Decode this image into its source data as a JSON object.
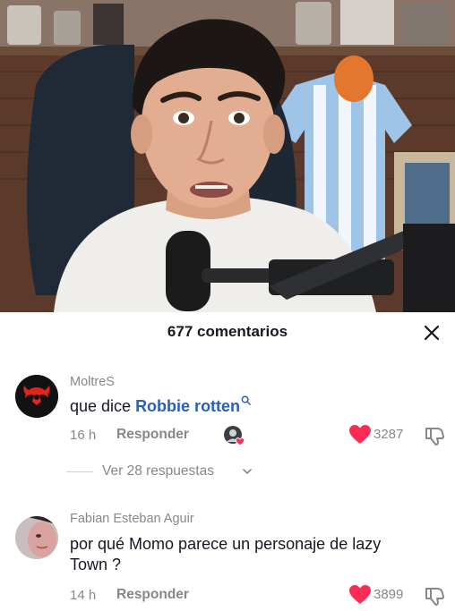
{
  "sheet": {
    "comment_count_label": "677 comentarios"
  },
  "comments": [
    {
      "username": "MoltreS",
      "text_plain": "que dice ",
      "text_link": "Robbie rotten",
      "time": "16 h",
      "reply_label": "Responder",
      "likes": "3287",
      "replies_label": "Ver 28 respuestas"
    },
    {
      "username": "Fabian Esteban Aguir",
      "text_line1": "por qué Momo parece un personaje de lazy",
      "text_line2": "Town ?",
      "time": "14 h",
      "reply_label": "Responder",
      "likes": "3899"
    }
  ],
  "colors": {
    "like_red": "#fe2c55",
    "muted_text": "#86878b",
    "link_blue": "#2b5db9"
  },
  "icons": [
    "close-icon",
    "heart-icon",
    "dislike-icon",
    "search-icon",
    "chevron-down-icon",
    "creator-liked-icon"
  ]
}
